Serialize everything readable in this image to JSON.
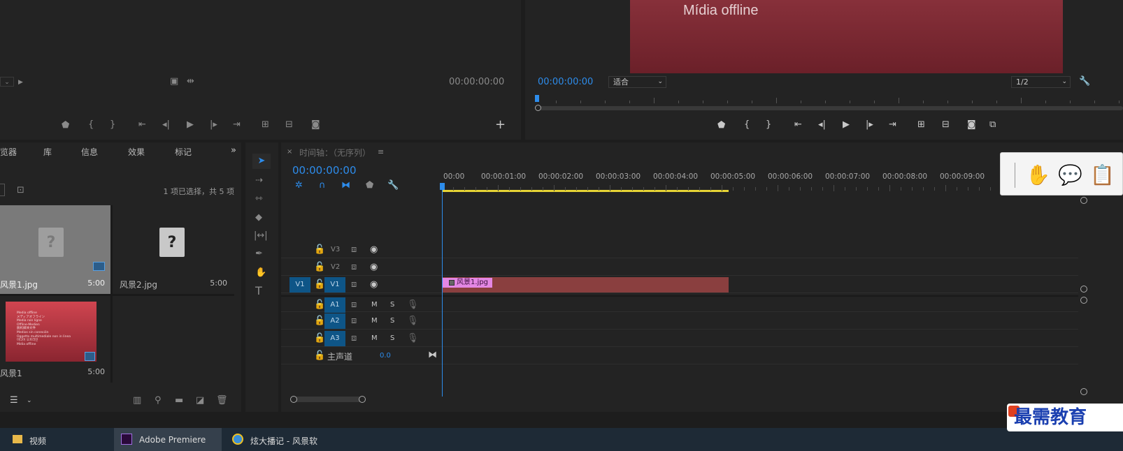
{
  "source_monitor": {
    "timecode": "00:00:00:00"
  },
  "program_monitor": {
    "offline_text": "Mídia offline",
    "timecode": "00:00:00:00",
    "zoom": "适合",
    "resolution": "1/2"
  },
  "project_panel": {
    "tabs": [
      "览器",
      "库",
      "信息",
      "效果",
      "标记"
    ],
    "selection_status": "1 项已选择，共 5 项",
    "items": [
      {
        "name": "风景1.jpg",
        "duration": "5:00"
      },
      {
        "name": "风景2.jpg",
        "duration": "5:00"
      },
      {
        "name": "风景1",
        "duration": "5:00"
      }
    ],
    "thumb_lines": [
      "Media offline",
      "メディアオフライン",
      "Media non ligne",
      "Offline-Medien",
      "脱机媒体文件",
      "Medios sin conexión",
      "Oggetto multimediale non in linea",
      "미디어 오프라인",
      "Mídia offline"
    ]
  },
  "timeline": {
    "title": "时间轴：（无序列）",
    "timecode": "00:00:00:00",
    "ruler": [
      "00:00",
      "00:00:01:00",
      "00:00:02:00",
      "00:00:03:00",
      "00:00:04:00",
      "00:00:05:00",
      "00:00:06:00",
      "00:00:07:00",
      "00:00:08:00",
      "00:00:09:00"
    ],
    "video_tracks": [
      "V3",
      "V2",
      "V1"
    ],
    "audio_tracks": [
      "A1",
      "A2",
      "A3"
    ],
    "source_patch": "V1",
    "mute_label": "M",
    "solo_label": "S",
    "master": {
      "label": "主声道",
      "value": "0.0"
    },
    "clip": {
      "name": "风景1.jpg",
      "duration_seconds": 5
    }
  },
  "taskbar": {
    "items": [
      "视频",
      "Adobe Premiere",
      "炫大播记 - 风景软"
    ]
  },
  "watermark": "最需教育"
}
